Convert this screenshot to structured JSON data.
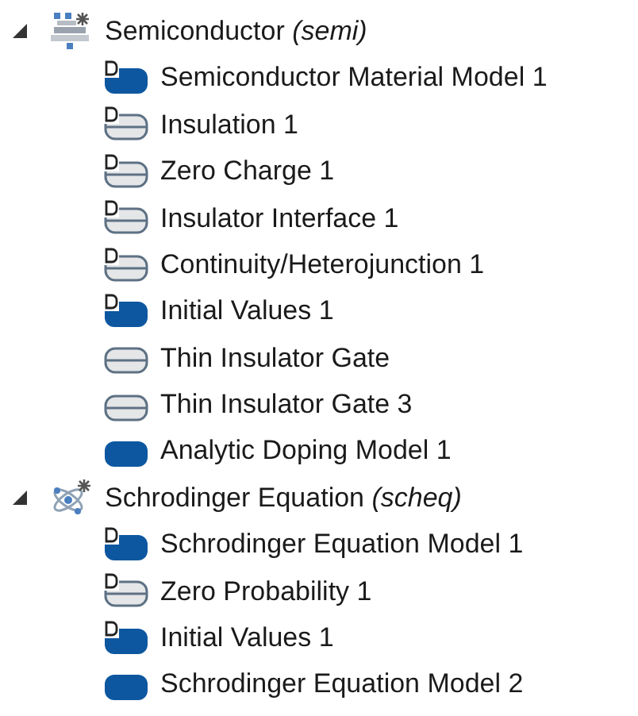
{
  "tree": [
    {
      "label": "Semiconductor *(semi)*",
      "kind": "semiconductor",
      "expanded": true,
      "children": [
        {
          "label": "Semiconductor Material Model 1",
          "kind": "domain",
          "default": true
        },
        {
          "label": "Insulation 1",
          "kind": "boundary",
          "default": true
        },
        {
          "label": "Zero Charge 1",
          "kind": "boundary",
          "default": true
        },
        {
          "label": "Insulator Interface 1",
          "kind": "boundary",
          "default": true
        },
        {
          "label": "Continuity/Heterojunction 1",
          "kind": "boundary",
          "default": true
        },
        {
          "label": "Initial Values 1",
          "kind": "domain",
          "default": true
        },
        {
          "label": "Thin Insulator Gate",
          "kind": "boundary",
          "default": false
        },
        {
          "label": "Thin Insulator Gate 3",
          "kind": "boundary",
          "default": false
        },
        {
          "label": "Analytic Doping Model 1",
          "kind": "domain",
          "default": false
        }
      ]
    },
    {
      "label": "Schrodinger Equation *(scheq)*",
      "kind": "schrodinger",
      "expanded": true,
      "children": [
        {
          "label": "Schrodinger Equation Model 1",
          "kind": "domain",
          "default": true
        },
        {
          "label": "Zero Probability 1",
          "kind": "boundary",
          "default": true
        },
        {
          "label": "Initial Values 1",
          "kind": "domain",
          "default": true
        },
        {
          "label": "Schrodinger Equation Model 2",
          "kind": "domain",
          "default": false
        }
      ]
    }
  ]
}
